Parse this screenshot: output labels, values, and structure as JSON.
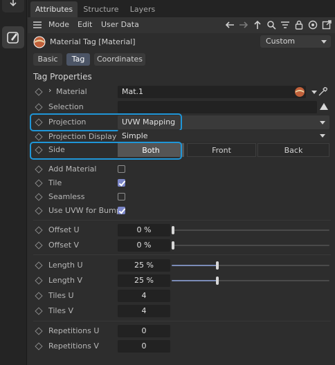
{
  "tabs": [
    "Attributes",
    "Structure",
    "Layers"
  ],
  "toolbar": {
    "menu": [
      "Mode",
      "Edit",
      "User Data"
    ],
    "icons": [
      "back-arrow-icon",
      "forward-arrow-icon",
      "up-arrow-icon",
      "search-icon",
      "filter-icon",
      "lock-icon",
      "target-icon",
      "new-window-icon"
    ]
  },
  "object": {
    "title": "Material Tag [Material]",
    "mode": "Custom"
  },
  "subtabs": [
    "Basic",
    "Tag",
    "Coordinates"
  ],
  "section_title": "Tag Properties",
  "props": {
    "material": {
      "label": "Material",
      "value": "Mat.1"
    },
    "selection": {
      "label": "Selection",
      "value": ""
    },
    "projection": {
      "label": "Projection",
      "value": "UVW Mapping"
    },
    "projection_display": {
      "label": "Projection Display",
      "value": "Simple"
    },
    "side": {
      "label": "Side",
      "options": [
        "Both",
        "Front",
        "Back"
      ],
      "selected": "Both"
    },
    "add_material": {
      "label": "Add Material",
      "checked": false
    },
    "tile": {
      "label": "Tile",
      "checked": true
    },
    "seamless": {
      "label": "Seamless",
      "checked": false
    },
    "use_uvw_bump": {
      "label": "Use UVW for Bump",
      "checked": true
    },
    "offset_u": {
      "label": "Offset U",
      "value": "0 %",
      "level": 0
    },
    "offset_v": {
      "label": "Offset V",
      "value": "0 %",
      "level": 0
    },
    "length_u": {
      "label": "Length U",
      "value": "25 %",
      "level": 0.29
    },
    "length_v": {
      "label": "Length V",
      "value": "25 %",
      "level": 0.29
    },
    "tiles_u": {
      "label": "Tiles U",
      "value": "4"
    },
    "tiles_v": {
      "label": "Tiles V",
      "value": "4"
    },
    "repetitions_u": {
      "label": "Repetitions U",
      "value": "0"
    },
    "repetitions_v": {
      "label": "Repetitions V",
      "value": "0"
    }
  },
  "colors": {
    "highlight": "#1f96d8",
    "checkbox_on": "#7b86c8",
    "slider_fill": "#7b8cb8",
    "active_tab": "#4c5566"
  }
}
